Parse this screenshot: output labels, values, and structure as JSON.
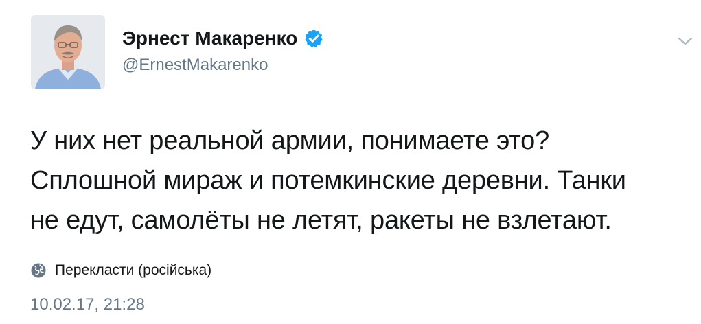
{
  "author": {
    "display_name": "Эрнест Макаренко",
    "handle": "@ErnestMakarenko",
    "avatar_icon": "profile-photo",
    "verified_icon": "verified-badge-icon",
    "verified_color": "#1da1f2"
  },
  "tweet": {
    "lines": [
      "У них нет реальной армии, понимаете это?",
      "Сплошной мираж и потемкинские деревни. Танки",
      "не едут, самолёты не летят, ракеты не взлетают."
    ],
    "translate_label": "Перекласти (російська)",
    "translate_icon": "globe-icon",
    "timestamp": "10.02.17, 21:28"
  },
  "menu": {
    "icon": "chevron-down-icon"
  },
  "colors": {
    "text": "#14171a",
    "secondary": "#657786",
    "accent": "#1da1f2"
  }
}
